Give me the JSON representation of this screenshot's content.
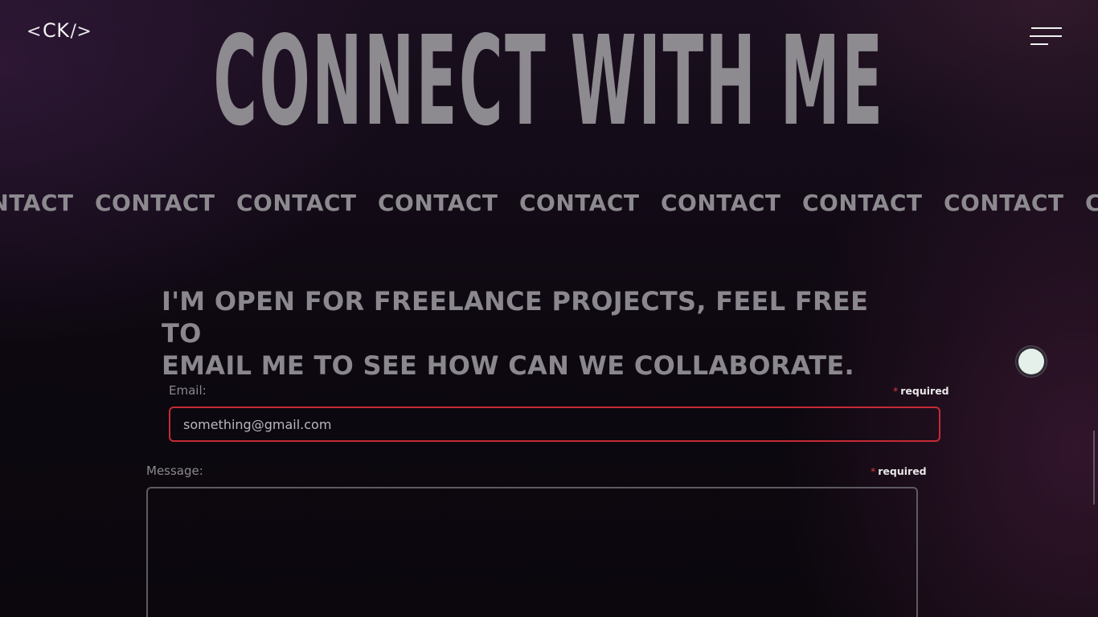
{
  "header": {
    "logo": {
      "open": "<",
      "text": "CK",
      "close": "/>"
    },
    "menu_icon": "hamburger-menu-icon"
  },
  "hero": {
    "title": "CONNECT WITH ME"
  },
  "marquee": {
    "items": [
      "CONTACT",
      "CONTACT",
      "CONTACT",
      "CONTACT",
      "CONTACT",
      "CONTACT",
      "CONTACT",
      "CONTACT",
      "CONTACT"
    ]
  },
  "intro": {
    "line1": "I'M OPEN FOR FREELANCE PROJECTS, FEEL FREE TO",
    "line2": "EMAIL ME TO SEE HOW CAN WE COLLABORATE."
  },
  "form": {
    "email": {
      "label": "Email:",
      "required_star": "*",
      "required_text": "required",
      "value": "something@gmail.com"
    },
    "message": {
      "label": "Message:",
      "required_star": "*",
      "required_text": "required",
      "value": ""
    }
  },
  "colors": {
    "error_border": "#c72a34",
    "required_star": "#d23a3a",
    "cursor_dot": "#e6f0ea"
  }
}
